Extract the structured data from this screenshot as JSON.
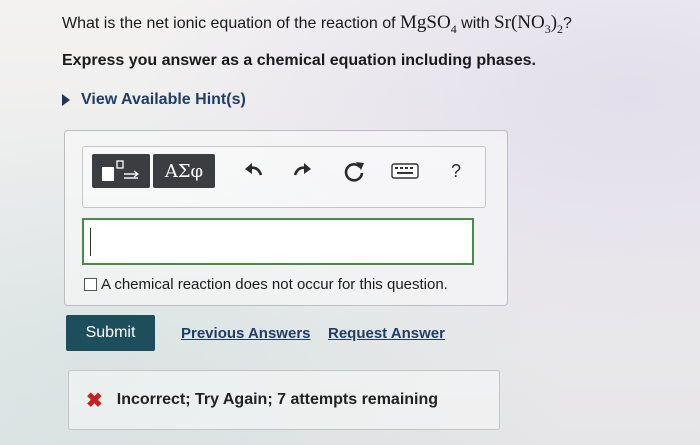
{
  "question": {
    "prefix": "What is the net ionic equation of the reaction of",
    "reagent1": {
      "base": "MgSO",
      "sub": "4"
    },
    "with": "with",
    "reagent2": {
      "base": "Sr(NO",
      "sub1": "3",
      "close": ")",
      "sub2": "2"
    },
    "suffix": "?"
  },
  "instruction": "Express you answer as a chemical equation including phases.",
  "hints_link": "View Available Hint(s)",
  "toolbar": {
    "greek_label": "ΑΣφ",
    "help_label": "?",
    "icons": [
      "templates-icon",
      "greek-letters-icon",
      "undo-icon",
      "redo-icon",
      "reset-icon",
      "keyboard-icon",
      "help-icon"
    ]
  },
  "answer": {
    "value": ""
  },
  "no_reaction_label": "A chemical reaction does not occur for this question.",
  "actions": {
    "submit": "Submit",
    "previous_answers": "Previous Answers",
    "request_answer": "Request Answer"
  },
  "feedback": {
    "text": "Incorrect; Try Again; 7 attempts remaining"
  },
  "colors": {
    "link": "#1f3d66",
    "submit_bg": "#1c4e5c",
    "error": "#c42323",
    "input_border": "#4a8a4a",
    "toolbar_button": "#3b3d40"
  }
}
